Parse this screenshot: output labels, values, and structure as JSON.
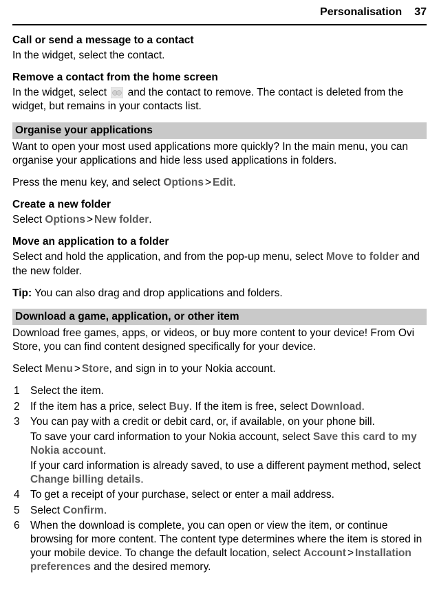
{
  "header": {
    "title": "Personalisation",
    "page": "37"
  },
  "s1": {
    "heading": "Call or send a message to a contact",
    "para": "In the widget, select the contact."
  },
  "s2": {
    "heading": "Remove a contact from the home screen",
    "pre": "In the widget, select ",
    "post": " and the contact to remove. The contact is deleted from the widget, but remains in your contacts list."
  },
  "bar1": "Organise your applications",
  "s3": {
    "para1": "Want to open your most used applications more quickly? In the main menu, you can organise your applications and hide less used applications in folders.",
    "para2_pre": "Press the menu key, and select ",
    "options": "Options",
    "gt": ">",
    "edit": "Edit",
    "para2_post": "."
  },
  "s4": {
    "heading": "Create a new folder",
    "pre": "Select ",
    "options": "Options",
    "gt": ">",
    "newfolder": "New folder",
    "post": "."
  },
  "s5": {
    "heading": "Move an application to a folder",
    "pre": "Select and hold the application, and from the pop-up menu, select ",
    "move": "Move to folder",
    "post": " and the new folder."
  },
  "tip": {
    "label": "Tip:",
    "text": " You can also drag and drop applications and folders."
  },
  "bar2": "Download a game, application, or other item",
  "s6": {
    "para1": "Download free games, apps, or videos, or buy more content to your device! From Ovi Store, you can find content designed specifically for your device.",
    "para2_pre": "Select ",
    "menu": "Menu",
    "gt": ">",
    "store": "Store",
    "para2_post": ", and sign in to your Nokia account."
  },
  "list": {
    "n1": "1",
    "i1": "Select the item.",
    "n2": "2",
    "i2_pre": "If the item has a price, select ",
    "i2_buy": "Buy",
    "i2_mid": ". If the item is free, select ",
    "i2_dl": "Download",
    "i2_post": ".",
    "n3": "3",
    "i3a": "You can pay with a credit or debit card, or, if available, on your phone bill.",
    "i3b_pre": "To save your card information to your Nokia account, select ",
    "i3b_save": "Save this card to my Nokia account",
    "i3b_post": ".",
    "i3c_pre": "If your card information is already saved, to use a different payment method, select ",
    "i3c_change": "Change billing details",
    "i3c_post": ".",
    "n4": "4",
    "i4": "To get a receipt of your purchase, select or enter a mail address.",
    "n5": "5",
    "i5_pre": "Select ",
    "i5_confirm": "Confirm",
    "i5_post": ".",
    "n6": "6",
    "i6_pre": "When the download is complete, you can open or view the item, or continue browsing for more content. The content type determines where the item is stored in your mobile device. To change the default location, select ",
    "i6_account": "Account",
    "i6_gt": ">",
    "i6_install": "Installation preferences",
    "i6_post": " and the desired memory."
  }
}
